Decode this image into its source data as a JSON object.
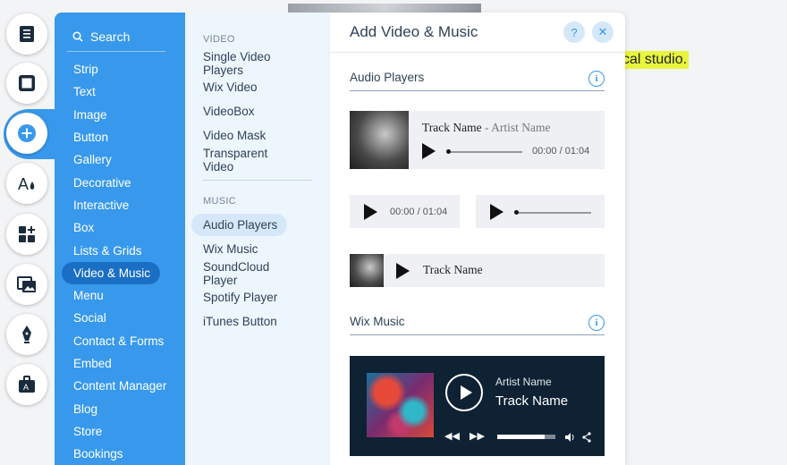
{
  "canvas": {
    "highlight_text": "cal studio."
  },
  "rail": {
    "buttons": [
      {
        "icon": "pages-icon"
      },
      {
        "icon": "background-icon"
      },
      {
        "icon": "add-icon"
      },
      {
        "icon": "theme-icon"
      },
      {
        "icon": "apps-icon"
      },
      {
        "icon": "media-icon"
      },
      {
        "icon": "pen-icon"
      },
      {
        "icon": "business-icon"
      }
    ]
  },
  "categories": {
    "search_label": "Search",
    "items": [
      "Strip",
      "Text",
      "Image",
      "Button",
      "Gallery",
      "Decorative",
      "Interactive",
      "Box",
      "Lists & Grids",
      "Video & Music",
      "Menu",
      "Social",
      "Contact & Forms",
      "Embed",
      "Content Manager",
      "Blog",
      "Store",
      "Bookings"
    ],
    "selected": "Video & Music"
  },
  "subcategories": {
    "video_header": "VIDEO",
    "video_items": [
      "Single Video Players",
      "Wix Video",
      "VideoBox",
      "Video Mask",
      "Transparent Video"
    ],
    "music_header": "MUSIC",
    "music_items": [
      "Audio Players",
      "Wix Music",
      "SoundCloud Player",
      "Spotify Player",
      "iTunes Button"
    ],
    "selected": "Audio Players"
  },
  "panel": {
    "title": "Add Video & Music",
    "help_label": "?",
    "close_label": "✕",
    "audio_section": "Audio Players",
    "info_label": "i",
    "player1": {
      "track": "Track Name",
      "separator": "-",
      "artist": "Artist Name",
      "time": "00:00 / 01:04"
    },
    "player2": {
      "time": "00:00 / 01:04"
    },
    "player4": {
      "track": "Track Name"
    },
    "wix_section": "Wix Music",
    "wix_player": {
      "artist": "Artist Name",
      "track": "Track Name",
      "progress": 0.82
    }
  }
}
